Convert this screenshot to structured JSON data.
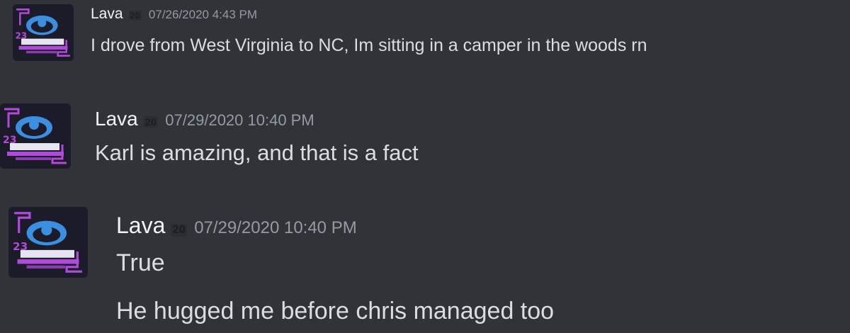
{
  "colors": {
    "background": "#313338",
    "username": "#f2f3f5",
    "timestamp": "#949ba4",
    "message_text": "#dbdee1",
    "avatar_accent": "#b04ad8",
    "avatar_blue": "#3a8fe0"
  },
  "messages": [
    {
      "avatar_icon": "user-avatar-icon",
      "username": "Lava",
      "badge": "20",
      "timestamp": "07/26/2020 4:43 PM",
      "lines": [
        "I drove from West Virginia to NC, Im sitting in a camper in the woods rn"
      ]
    },
    {
      "avatar_icon": "user-avatar-icon",
      "username": "Lava",
      "badge": "20",
      "timestamp": "07/29/2020 10:40 PM",
      "lines": [
        "Karl is amazing, and that is a fact"
      ]
    },
    {
      "avatar_icon": "user-avatar-icon",
      "username": "Lava",
      "badge": "20",
      "timestamp": "07/29/2020 10:40 PM",
      "lines": [
        "True",
        "He hugged me before chris managed too"
      ]
    }
  ]
}
